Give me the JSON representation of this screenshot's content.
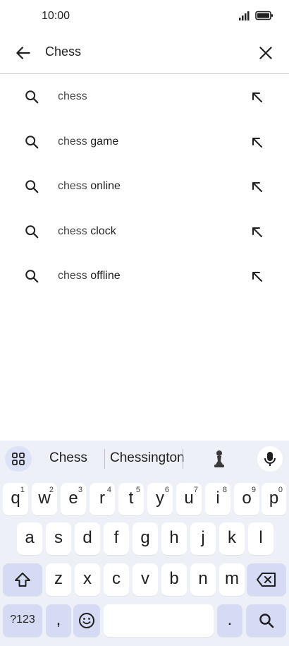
{
  "status": {
    "time": "10:00"
  },
  "search": {
    "query": "Chess"
  },
  "suggestions": [
    {
      "prefix": "chess",
      "rest": ""
    },
    {
      "prefix": "chess",
      "rest": " game"
    },
    {
      "prefix": "chess",
      "rest": " online"
    },
    {
      "prefix": "chess",
      "rest": " clock"
    },
    {
      "prefix": "chess",
      "rest": " offline"
    }
  ],
  "keyboard": {
    "suggestions": [
      "Chess",
      "Chessington"
    ],
    "row1": [
      {
        "k": "q",
        "s": "1"
      },
      {
        "k": "w",
        "s": "2"
      },
      {
        "k": "e",
        "s": "3"
      },
      {
        "k": "r",
        "s": "4"
      },
      {
        "k": "t",
        "s": "5"
      },
      {
        "k": "y",
        "s": "6"
      },
      {
        "k": "u",
        "s": "7"
      },
      {
        "k": "i",
        "s": "8"
      },
      {
        "k": "o",
        "s": "9"
      },
      {
        "k": "p",
        "s": "0"
      }
    ],
    "row2": [
      "a",
      "s",
      "d",
      "f",
      "g",
      "h",
      "j",
      "k",
      "l"
    ],
    "row3": [
      "z",
      "x",
      "c",
      "v",
      "b",
      "n",
      "m"
    ],
    "symbols_label": "?123",
    "comma": ",",
    "period": "."
  }
}
